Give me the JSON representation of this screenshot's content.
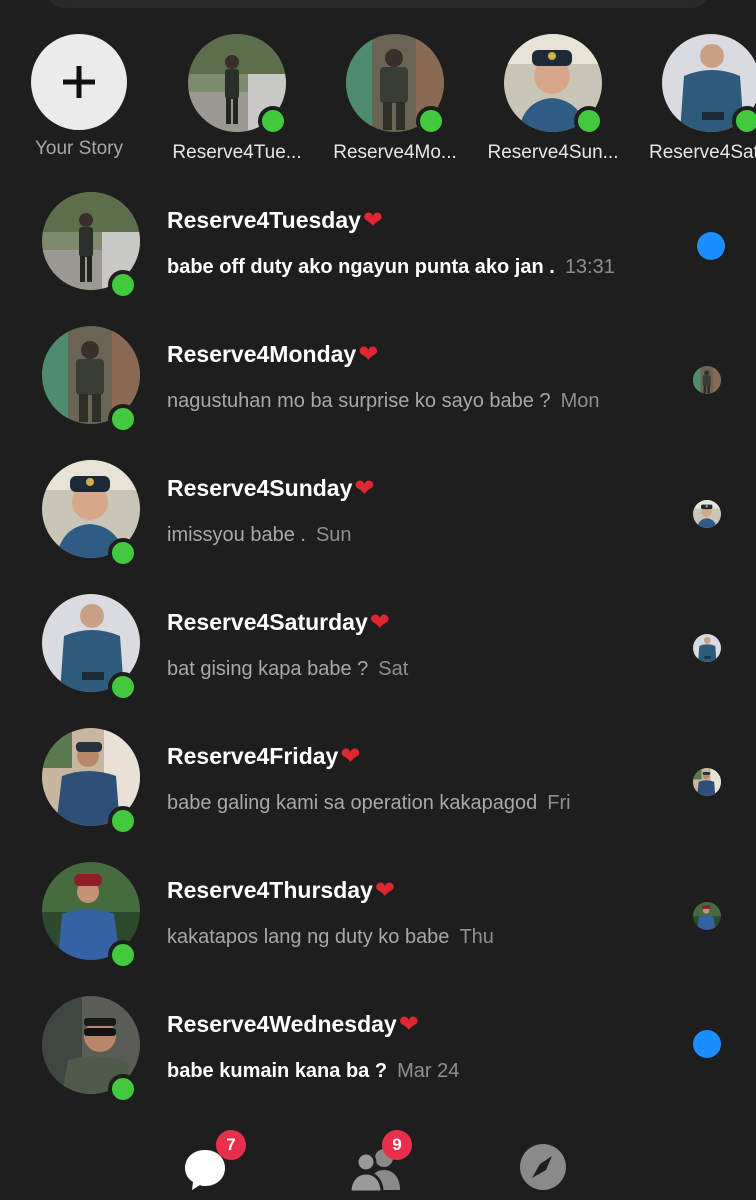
{
  "stories": {
    "add_label": "Your Story",
    "items": [
      {
        "label": "Reserve4Tue..."
      },
      {
        "label": "Reserve4Mo..."
      },
      {
        "label": "Reserve4Sun..."
      },
      {
        "label": "Reserve4Sat"
      }
    ]
  },
  "conversations": [
    {
      "name": "Reserve4Tuesday",
      "heart": "❤",
      "message": "babe off duty ako ngayun punta ako jan .",
      "time": "13:31",
      "unread": true
    },
    {
      "name": "Reserve4Monday",
      "heart": "❤",
      "message": "nagustuhan mo ba surprise ko sayo babe ?",
      "time": "Mon",
      "unread": false
    },
    {
      "name": "Reserve4Sunday",
      "heart": "❤",
      "message": "imissyou babe .",
      "time": "Sun",
      "unread": false
    },
    {
      "name": "Reserve4Saturday",
      "heart": "❤",
      "message": "bat gising kapa babe ?",
      "time": "Sat",
      "unread": false
    },
    {
      "name": "Reserve4Friday",
      "heart": "❤",
      "message": "babe galing kami sa operation kakapagod",
      "time": "Fri",
      "unread": false
    },
    {
      "name": "Reserve4Thursday",
      "heart": "❤",
      "message": "kakatapos lang ng duty ko babe",
      "time": "Thu",
      "unread": false
    },
    {
      "name": "Reserve4Wednesday",
      "heart": "❤",
      "message": "babe kumain kana ba ?",
      "time": "Mar 24",
      "unread": true
    }
  ],
  "bottom_nav": {
    "chats_badge": "7",
    "people_badge": "9"
  },
  "colors": {
    "background": "#1e1e1e",
    "online": "#43c93e",
    "unread_dot": "#1b8fff",
    "badge": "#e8304a",
    "heart": "#e0262e"
  }
}
